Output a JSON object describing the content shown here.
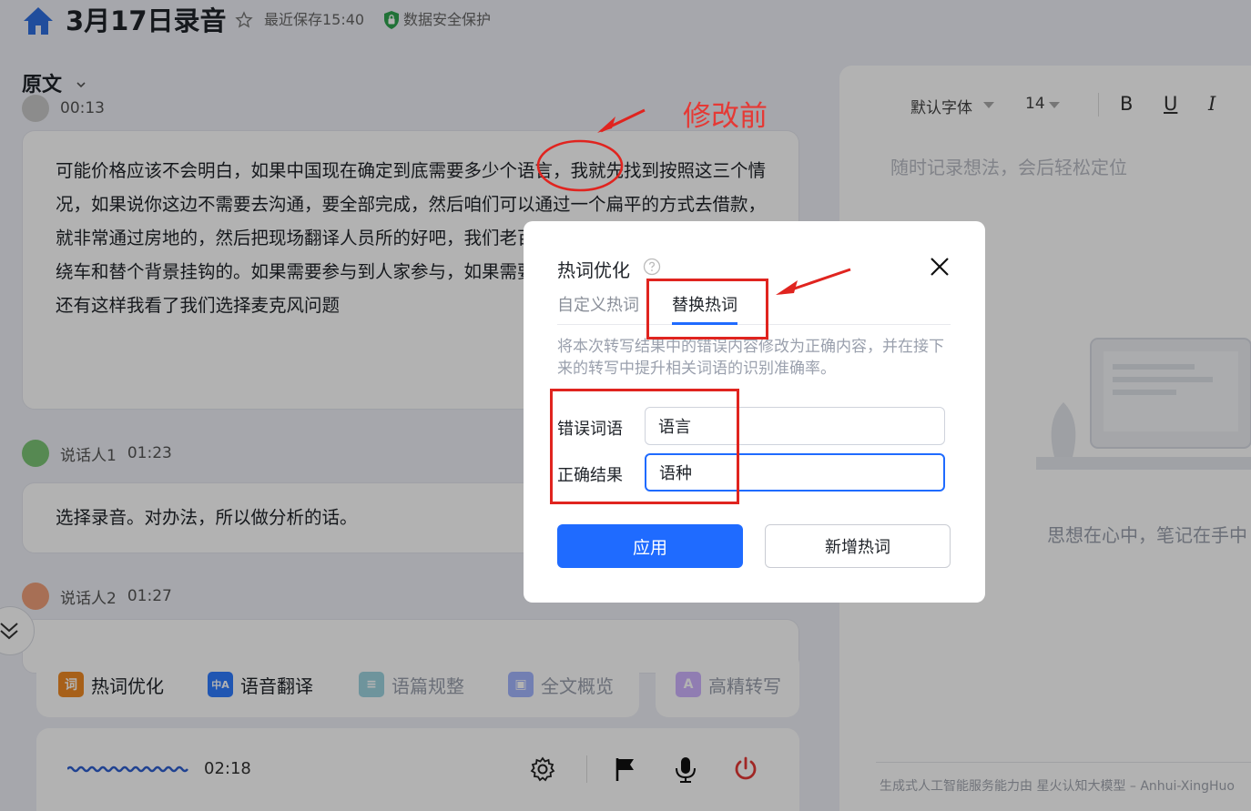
{
  "header": {
    "title": "3月17日录音",
    "save_time": "最近保存15:40",
    "security": "数据安全保护"
  },
  "section": {
    "title": "原文"
  },
  "transcript": [
    {
      "speaker": "",
      "time": "00:13",
      "avatar_color": "#c9c9c9",
      "text": "可能价格应该不会明白，如果中国现在确定到底需要多少个语言，我就先找到按照这三个情况，如果说你这边不需要去沟通，要全部完成，然后咱们可以通过一个扁平的方式去借款，就非常通过房地的，然后把现场翻译人员所的好吧，我们老百姓好吧？二次优化包括自定义绕车和替个背景挂钩的。如果需要参与到人家参与，如果需要参与样好好的，其实改革我们还有这样我看了我们选择麦克风问题"
    },
    {
      "speaker": "说话人1",
      "time": "01:23",
      "avatar_color": "#7cc576",
      "text": "选择录音。对办法，所以做分析的话。"
    },
    {
      "speaker": "说话人2",
      "time": "01:27",
      "avatar_color": "#f0a07a",
      "text": ""
    }
  ],
  "tools": [
    {
      "label": "热词优化",
      "icon_text": "词",
      "icon_color": "#f08a24",
      "enabled": true
    },
    {
      "label": "语音翻译",
      "icon_text": "中A",
      "icon_color": "#2f7bff",
      "enabled": true
    },
    {
      "label": "语篇规整",
      "icon_text": "≡",
      "icon_color": "#4fb3c8",
      "enabled": false
    },
    {
      "label": "全文概览",
      "icon_text": "▣",
      "icon_color": "#5a7cff",
      "enabled": false
    },
    {
      "label": "高精转写",
      "icon_text": "A",
      "icon_color": "#a876ff",
      "enabled": false
    }
  ],
  "player": {
    "time": "02:18"
  },
  "editor": {
    "font": "默认字体",
    "size": "14",
    "bold": "B",
    "underline": "U",
    "italic": "I",
    "placeholder": "随时记录想法，会后轻松定位",
    "empty_slogan": "思想在心中，笔记在手中",
    "footer": "生成式人工智能服务能力由 星火认知大模型 – Anhui-XingHuo"
  },
  "modal": {
    "title": "热词优化",
    "tabs": [
      {
        "label": "自定义热词"
      },
      {
        "label": "替换热词"
      }
    ],
    "active_tab": "替换热词",
    "description": "将本次转写结果中的错误内容修改为正确内容，并在接下来的转写中提升相关词语的识别准确率。",
    "wrong_label": "错误词语",
    "wrong_value": "语言",
    "correct_label": "正确结果",
    "correct_value": "语种",
    "apply_label": "应用",
    "add_label": "新增热词"
  },
  "annotation": {
    "label": "修改前",
    "color": "#e53935"
  }
}
